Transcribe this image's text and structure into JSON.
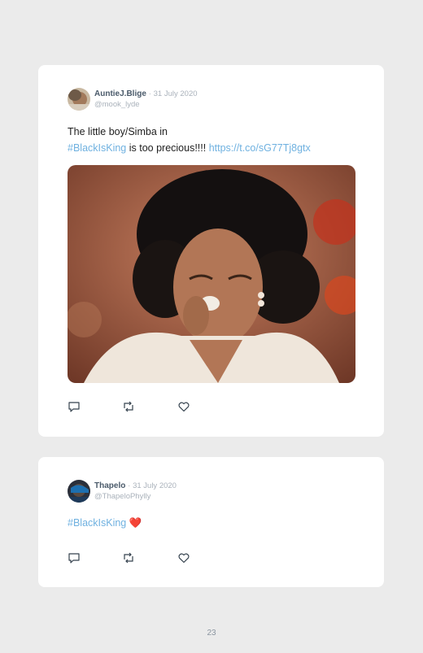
{
  "tweets": [
    {
      "display_name": "AuntieJ.Blige",
      "separator": "·",
      "date": "31 July 2020",
      "handle": "@mook_lyde",
      "text_line1": "The little boy/Simba in",
      "hashtag": "#BlackIsKing",
      "text_after_hashtag": " is too precious!!!! ",
      "link": "https://t.co/sG77Tj8gtx",
      "has_media": true
    },
    {
      "display_name": "Thapelo",
      "separator": "·",
      "date": "31 July 2020",
      "handle": "@ThapeloPhylly",
      "hashtag": "#BlackIsKing",
      "emoji": "❤️"
    }
  ],
  "icons": {
    "reply": "reply-icon",
    "retweet": "retweet-icon",
    "like": "heart-icon"
  },
  "colors": {
    "hashtag": "#6fb1e0",
    "heart_emoji": "#d7263d",
    "page_background": "#ebebeb",
    "card_background": "#ffffff"
  },
  "footer": {
    "page_number": "23"
  }
}
